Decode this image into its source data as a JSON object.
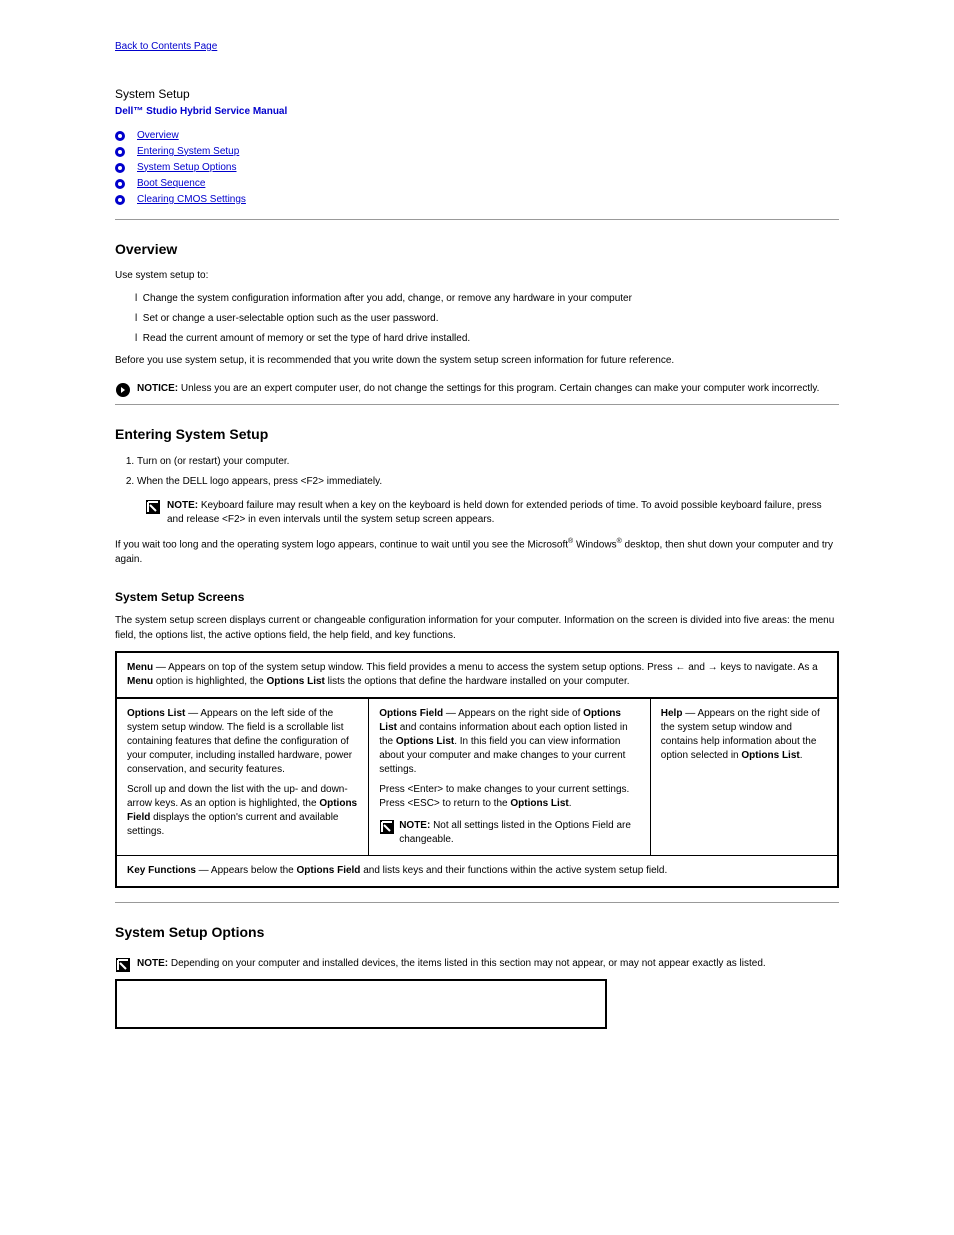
{
  "back_link": "Back to Contents Page",
  "page_title": "System Setup",
  "manual_subtitle": "Dell™ Studio Hybrid Service Manual",
  "toc": [
    "Overview",
    "Entering System Setup",
    "System Setup Options",
    "Boot Sequence",
    "Clearing CMOS Settings"
  ],
  "overview": {
    "heading": "Overview",
    "intro": "Use system setup to:",
    "items": [
      "Change the system configuration information after you add, change, or remove any hardware in your computer",
      "Set or change a user-selectable option such as the user password.",
      "Read the current amount of memory or set the type of hard drive installed."
    ],
    "preuse": "Before you use system setup, it is recommended that you write down the system setup screen information for future reference.",
    "notice_label": "NOTICE:",
    "notice_text": " Unless you are an expert computer user, do not change the settings for this program. Certain changes can make your computer work incorrectly."
  },
  "entering": {
    "heading": "Entering System Setup",
    "steps": [
      "Turn on (or restart) your computer.",
      "When the DELL logo appears, press <F2> immediately."
    ],
    "note_label": "NOTE:",
    "note_text": " Keyboard failure may result when a key on the keyboard is held down for extended periods of time. To avoid possible keyboard failure, press and release <F2> in even intervals until the system setup screen appears.",
    "wait_text_1": "If you wait too long and the operating system logo appears, continue to wait until you see the Microsoft",
    "wait_text_2": " Windows",
    "wait_text_3": " desktop, then shut down your computer and try again."
  },
  "screens": {
    "heading": "System Setup Screens",
    "para": "The system setup screen displays current or changeable configuration information for your computer. Information on the screen is divided into five areas: the menu field, the options list, the active options field, the help field, and key functions.",
    "menu_label": "Menu",
    "menu_desc": " — Appears on top of the system setup window. This field provides a menu to access the system setup options. Press ",
    "menu_keys_left": "←",
    "menu_and": " and ",
    "menu_keys_right": "→",
    "menu_desc2": " keys to navigate. As a ",
    "menu_label2": "Menu",
    "menu_desc3": " option is highlighted, the ",
    "menu_ol": "Options List",
    "menu_desc4": " lists the options that define the hardware installed on your computer.",
    "options_list_label": "Options List",
    "options_list_text": " — Appears on the left side of the system setup window. The field is a scrollable list containing features that define the configuration of your computer, including installed hardware, power conservation, and security features.",
    "options_list_text2": "Scroll up and down the list with the up- and down-arrow keys. As an option is highlighted, the ",
    "options_field_ref": "Options Field",
    "options_list_text3": " displays the option's current and available settings.",
    "options_field_label": "Options Field",
    "options_field_text": " — Appears on the right side of ",
    "options_field_ref2": "Options List",
    "options_field_text2": " and contains information about each option listed in the ",
    "options_field_ref3": "Options List",
    "options_field_text3": ". In this field you can view information about your computer and make changes to your current settings.",
    "options_field_text4": "Press <Enter> to make changes to your current settings. Press <ESC> to return to the ",
    "options_field_ref4": "Options List",
    "options_field_text5": ".",
    "options_field_note": " Not all settings listed in the Options Field are changeable.",
    "help_label": "Help",
    "help_text": " — Appears on the right side of the system setup window and contains help information about the option selected in ",
    "help_ref": "Options List",
    "help_text2": ".",
    "keyfn_label": "Key Functions",
    "keyfn_text": " — Appears below the ",
    "keyfn_ref": "Options Field",
    "keyfn_text2": " and lists keys and their functions within the active system setup field."
  },
  "options": {
    "heading": "System Setup Options",
    "note_label": "NOTE:",
    "note_text": " Depending on your computer and installed devices, the items listed in this section may not appear, or may not appear exactly as listed."
  }
}
